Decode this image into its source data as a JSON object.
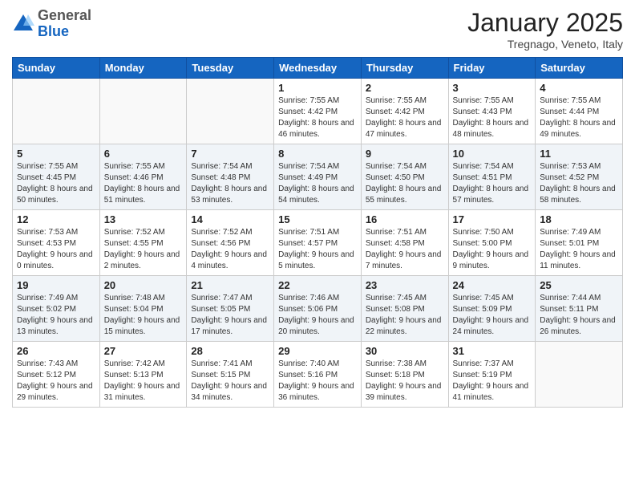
{
  "header": {
    "logo_general": "General",
    "logo_blue": "Blue",
    "month": "January 2025",
    "location": "Tregnago, Veneto, Italy"
  },
  "days_of_week": [
    "Sunday",
    "Monday",
    "Tuesday",
    "Wednesday",
    "Thursday",
    "Friday",
    "Saturday"
  ],
  "weeks": [
    {
      "days": [
        {
          "num": "",
          "info": ""
        },
        {
          "num": "",
          "info": ""
        },
        {
          "num": "",
          "info": ""
        },
        {
          "num": "1",
          "info": "Sunrise: 7:55 AM\nSunset: 4:42 PM\nDaylight: 8 hours and 46 minutes."
        },
        {
          "num": "2",
          "info": "Sunrise: 7:55 AM\nSunset: 4:42 PM\nDaylight: 8 hours and 47 minutes."
        },
        {
          "num": "3",
          "info": "Sunrise: 7:55 AM\nSunset: 4:43 PM\nDaylight: 8 hours and 48 minutes."
        },
        {
          "num": "4",
          "info": "Sunrise: 7:55 AM\nSunset: 4:44 PM\nDaylight: 8 hours and 49 minutes."
        }
      ]
    },
    {
      "days": [
        {
          "num": "5",
          "info": "Sunrise: 7:55 AM\nSunset: 4:45 PM\nDaylight: 8 hours and 50 minutes."
        },
        {
          "num": "6",
          "info": "Sunrise: 7:55 AM\nSunset: 4:46 PM\nDaylight: 8 hours and 51 minutes."
        },
        {
          "num": "7",
          "info": "Sunrise: 7:54 AM\nSunset: 4:48 PM\nDaylight: 8 hours and 53 minutes."
        },
        {
          "num": "8",
          "info": "Sunrise: 7:54 AM\nSunset: 4:49 PM\nDaylight: 8 hours and 54 minutes."
        },
        {
          "num": "9",
          "info": "Sunrise: 7:54 AM\nSunset: 4:50 PM\nDaylight: 8 hours and 55 minutes."
        },
        {
          "num": "10",
          "info": "Sunrise: 7:54 AM\nSunset: 4:51 PM\nDaylight: 8 hours and 57 minutes."
        },
        {
          "num": "11",
          "info": "Sunrise: 7:53 AM\nSunset: 4:52 PM\nDaylight: 8 hours and 58 minutes."
        }
      ]
    },
    {
      "days": [
        {
          "num": "12",
          "info": "Sunrise: 7:53 AM\nSunset: 4:53 PM\nDaylight: 9 hours and 0 minutes."
        },
        {
          "num": "13",
          "info": "Sunrise: 7:52 AM\nSunset: 4:55 PM\nDaylight: 9 hours and 2 minutes."
        },
        {
          "num": "14",
          "info": "Sunrise: 7:52 AM\nSunset: 4:56 PM\nDaylight: 9 hours and 4 minutes."
        },
        {
          "num": "15",
          "info": "Sunrise: 7:51 AM\nSunset: 4:57 PM\nDaylight: 9 hours and 5 minutes."
        },
        {
          "num": "16",
          "info": "Sunrise: 7:51 AM\nSunset: 4:58 PM\nDaylight: 9 hours and 7 minutes."
        },
        {
          "num": "17",
          "info": "Sunrise: 7:50 AM\nSunset: 5:00 PM\nDaylight: 9 hours and 9 minutes."
        },
        {
          "num": "18",
          "info": "Sunrise: 7:49 AM\nSunset: 5:01 PM\nDaylight: 9 hours and 11 minutes."
        }
      ]
    },
    {
      "days": [
        {
          "num": "19",
          "info": "Sunrise: 7:49 AM\nSunset: 5:02 PM\nDaylight: 9 hours and 13 minutes."
        },
        {
          "num": "20",
          "info": "Sunrise: 7:48 AM\nSunset: 5:04 PM\nDaylight: 9 hours and 15 minutes."
        },
        {
          "num": "21",
          "info": "Sunrise: 7:47 AM\nSunset: 5:05 PM\nDaylight: 9 hours and 17 minutes."
        },
        {
          "num": "22",
          "info": "Sunrise: 7:46 AM\nSunset: 5:06 PM\nDaylight: 9 hours and 20 minutes."
        },
        {
          "num": "23",
          "info": "Sunrise: 7:45 AM\nSunset: 5:08 PM\nDaylight: 9 hours and 22 minutes."
        },
        {
          "num": "24",
          "info": "Sunrise: 7:45 AM\nSunset: 5:09 PM\nDaylight: 9 hours and 24 minutes."
        },
        {
          "num": "25",
          "info": "Sunrise: 7:44 AM\nSunset: 5:11 PM\nDaylight: 9 hours and 26 minutes."
        }
      ]
    },
    {
      "days": [
        {
          "num": "26",
          "info": "Sunrise: 7:43 AM\nSunset: 5:12 PM\nDaylight: 9 hours and 29 minutes."
        },
        {
          "num": "27",
          "info": "Sunrise: 7:42 AM\nSunset: 5:13 PM\nDaylight: 9 hours and 31 minutes."
        },
        {
          "num": "28",
          "info": "Sunrise: 7:41 AM\nSunset: 5:15 PM\nDaylight: 9 hours and 34 minutes."
        },
        {
          "num": "29",
          "info": "Sunrise: 7:40 AM\nSunset: 5:16 PM\nDaylight: 9 hours and 36 minutes."
        },
        {
          "num": "30",
          "info": "Sunrise: 7:38 AM\nSunset: 5:18 PM\nDaylight: 9 hours and 39 minutes."
        },
        {
          "num": "31",
          "info": "Sunrise: 7:37 AM\nSunset: 5:19 PM\nDaylight: 9 hours and 41 minutes."
        },
        {
          "num": "",
          "info": ""
        }
      ]
    }
  ]
}
